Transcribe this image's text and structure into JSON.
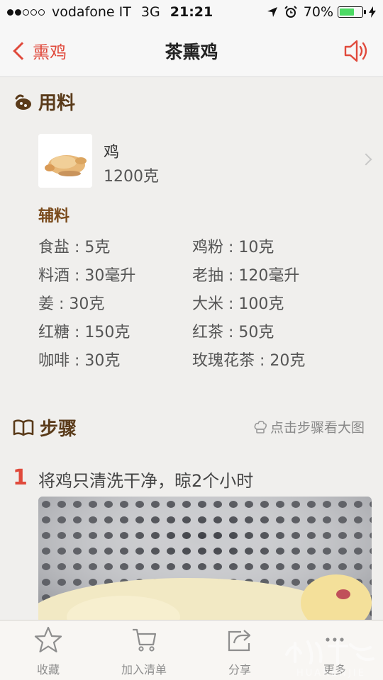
{
  "status": {
    "carrier": "vodafone IT",
    "network": "3G",
    "time": "21:21",
    "battery": "70%",
    "battery_level": 0.7
  },
  "nav": {
    "back_label": "熏鸡",
    "title": "茶熏鸡",
    "speaker_icon": "speaker-icon"
  },
  "ingredients": {
    "heading": "用料",
    "main": {
      "name": "鸡",
      "amount": "1200克"
    },
    "sub_heading": "辅料",
    "items": [
      {
        "name": "食盐",
        "amount": "5克"
      },
      {
        "name": "鸡粉",
        "amount": "10克"
      },
      {
        "name": "料酒",
        "amount": "30毫升"
      },
      {
        "name": "老抽",
        "amount": "120毫升"
      },
      {
        "name": "姜",
        "amount": "30克"
      },
      {
        "name": "大米",
        "amount": "100克"
      },
      {
        "name": "红糖",
        "amount": "150克"
      },
      {
        "name": "红茶",
        "amount": "50克"
      },
      {
        "name": "咖啡",
        "amount": "30克"
      },
      {
        "name": "玫瑰花茶",
        "amount": "20克"
      }
    ],
    "items_text": [
      "食盐 : 5克",
      "鸡粉 : 10克",
      "料酒 : 30毫升",
      "老抽 : 120毫升",
      "姜 : 30克",
      "大米 : 100克",
      "红糖 : 150克",
      "红茶 : 50克",
      "咖啡 : 30克",
      "玫瑰花茶 : 20克"
    ]
  },
  "steps": {
    "heading": "步骤",
    "hint": "点击步骤看大图",
    "list": [
      {
        "number": "1",
        "text": "将鸡只清洗干净，晾2个小时"
      }
    ]
  },
  "tabbar": {
    "items": [
      {
        "label": "收藏",
        "icon": "star-icon"
      },
      {
        "label": "加入清单",
        "icon": "cart-icon"
      },
      {
        "label": "分享",
        "icon": "share-icon"
      },
      {
        "label": "更多",
        "icon": "more-icon"
      }
    ]
  },
  "watermark": {
    "text": "HUARENJIE"
  },
  "colors": {
    "accent": "#e04a3c",
    "heading_brown": "#5a3b1a",
    "background": "#f0efed"
  }
}
